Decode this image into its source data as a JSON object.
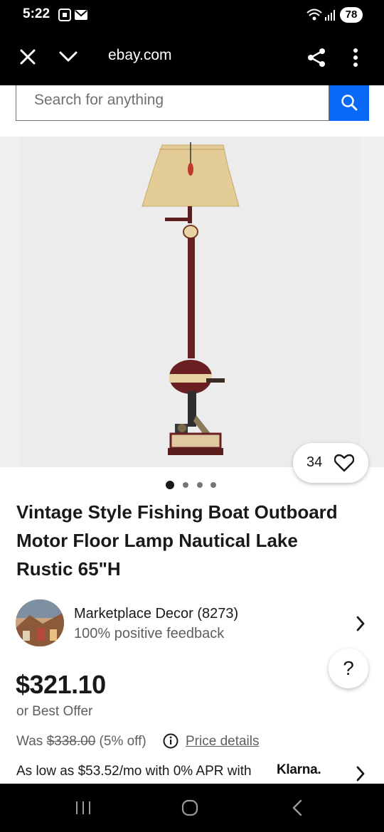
{
  "status_bar": {
    "time": "5:22",
    "battery": "78",
    "icons": [
      "screenshot-icon",
      "mail-icon",
      "wifi-icon",
      "signal-icon"
    ]
  },
  "browser": {
    "url": "ebay.com",
    "icons": [
      "close-icon",
      "chevron-down-icon",
      "share-icon",
      "more-icon"
    ]
  },
  "search": {
    "placeholder": "Search for anything",
    "button_icon": "search-icon",
    "accent": "#0968f6"
  },
  "gallery": {
    "watch_count": "34",
    "watch_icon": "heart-icon",
    "total_images": 4,
    "active_index": 0
  },
  "listing": {
    "title": "Vintage Style Fishing Boat Outboard Motor Floor Lamp Nautical Lake Rustic 65\"H"
  },
  "seller": {
    "name": "Marketplace Decor (8273)",
    "feedback": "100% positive feedback"
  },
  "help": {
    "label": "?"
  },
  "pricing": {
    "price": "$321.10",
    "best_offer": "or Best Offer",
    "was_label": "Was",
    "was_price": "$338.00",
    "discount": "(5% off)",
    "price_details": "Price details",
    "financing": "As low as $53.52/mo with 0% APR with",
    "klarna": "Klarna."
  },
  "nav_bar": {
    "icons": [
      "recent-apps-icon",
      "home-icon",
      "back-icon"
    ]
  }
}
